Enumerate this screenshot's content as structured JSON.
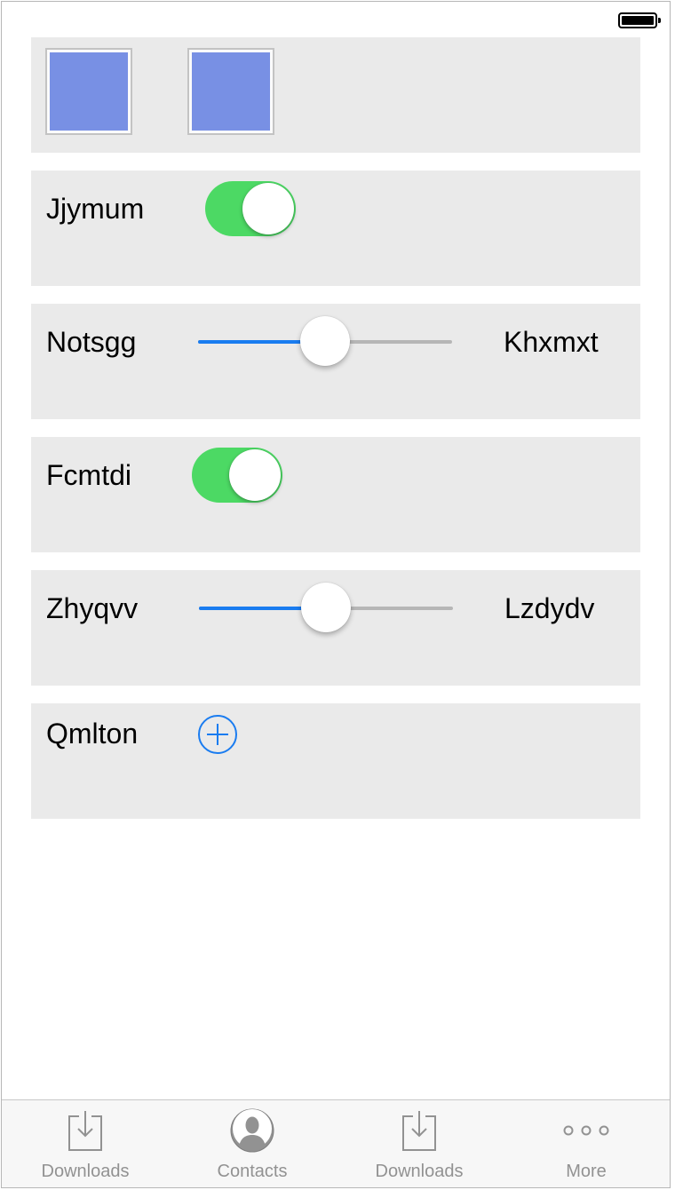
{
  "status_bar": {
    "battery_level": 1.0
  },
  "rows": [
    {
      "type": "swatches",
      "swatch_color": "#7890e4"
    },
    {
      "type": "toggle",
      "label": "Jjymum",
      "on": true
    },
    {
      "type": "slider",
      "label": "Notsgg",
      "trailing_label": "Khxmxt",
      "value": 0.5
    },
    {
      "type": "toggle",
      "label": "Fcmtdi",
      "on": true
    },
    {
      "type": "slider",
      "label": "Zhyqvv",
      "trailing_label": "Lzdydv",
      "value": 0.5
    },
    {
      "type": "add",
      "label": "Qmlton",
      "icon": "add-circle-icon"
    }
  ],
  "tabbar": {
    "tabs": [
      {
        "label": "Downloads",
        "icon": "download-tray-icon"
      },
      {
        "label": "Contacts",
        "icon": "contact-person-icon"
      },
      {
        "label": "Downloads",
        "icon": "download-tray-icon"
      },
      {
        "label": "More",
        "icon": "more-dots-icon"
      }
    ]
  },
  "colors": {
    "accent": "#1a7cf0",
    "toggle_on": "#4cd964",
    "card_background": "#eaeaea",
    "tab_label": "#929292"
  }
}
